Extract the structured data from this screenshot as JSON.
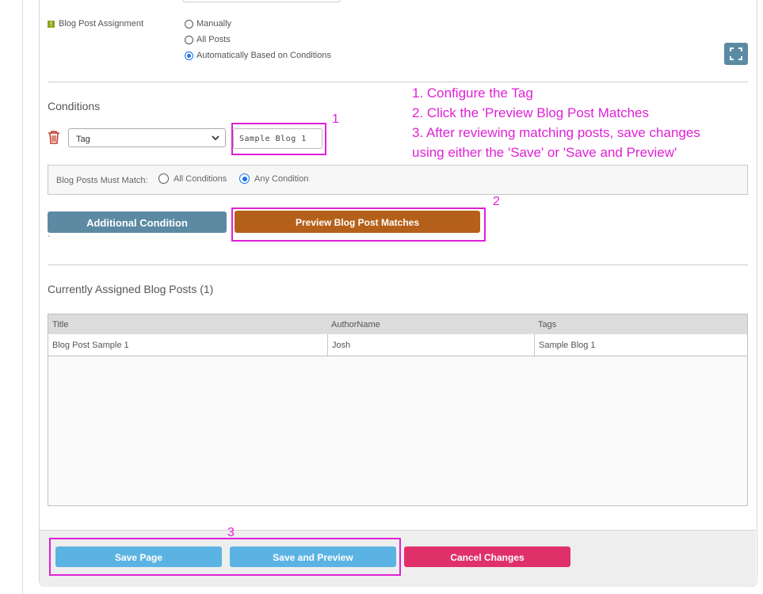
{
  "assignment": {
    "label": "Blog Post Assignment",
    "info_icon": "info-icon",
    "options": [
      {
        "label": "Manually",
        "selected": false
      },
      {
        "label": "All Posts",
        "selected": false
      },
      {
        "label": "Automatically Based on Conditions",
        "selected": true
      }
    ]
  },
  "expand_icon": "expand-icon",
  "conditions": {
    "title": "Conditions",
    "rows": [
      {
        "delete_icon": "trash-icon",
        "field": "Tag",
        "value": "Sample Blog 1"
      }
    ],
    "match": {
      "label": "Blog Posts Must Match:",
      "options": [
        {
          "label": "All Conditions",
          "selected": false
        },
        {
          "label": "Any Condition",
          "selected": true
        }
      ]
    },
    "add_button": "Additional Condition",
    "preview_button": "Preview Blog Post Matches",
    "tick_mark": "`"
  },
  "annotations": {
    "color": "#e020d6",
    "markers": [
      "1",
      "2",
      "3"
    ],
    "instructions": [
      "1. Configure the Tag",
      "2. Click the 'Preview Blog Post Matches",
      "3. After reviewing matching posts, save changes",
      "using either the 'Save' or 'Save and Preview'"
    ]
  },
  "assigned": {
    "title": "Currently Assigned Blog Posts (1)",
    "columns": [
      "Title",
      "AuthorName",
      "Tags"
    ],
    "rows": [
      [
        "Blog Post Sample 1",
        "Josh",
        "Sample Blog 1"
      ]
    ]
  },
  "footer": {
    "save": "Save Page",
    "save_preview": "Save and Preview",
    "cancel": "Cancel Changes"
  },
  "colors": {
    "add_condition": "#5c8aa3",
    "preview": "#b5601a",
    "save": "#5bb3e3",
    "cancel": "#e0306a"
  }
}
